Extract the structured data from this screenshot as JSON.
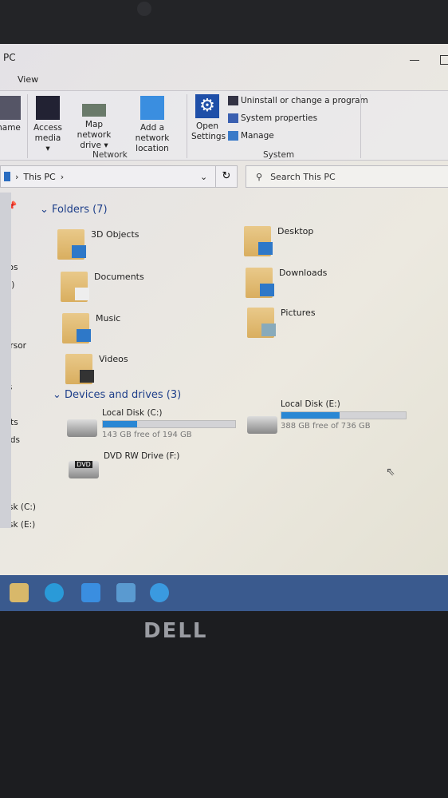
{
  "window": {
    "title": "PC",
    "tab": "View"
  },
  "ribbon": {
    "rename": "name",
    "access_media": "Access media ▾",
    "map_drive": "Map network drive ▾",
    "add_location": "Add a network location",
    "network_group": "Network",
    "open_settings": "Open Settings",
    "uninstall": "Uninstall or change a program",
    "system_properties": "System properties",
    "manage": "Manage",
    "system_group": "System"
  },
  "address": {
    "path": "This PC",
    "search_placeholder": "Search This PC"
  },
  "nav": [
    "otos",
    "(E:)",
    "Persor",
    "cts",
    "ents",
    "oads",
    "es",
    ":",
    "Disk (C:)",
    "Disk (E:)"
  ],
  "folders": {
    "header": "Folders (7)",
    "items": [
      "3D Objects",
      "Desktop",
      "Documents",
      "Downloads",
      "Music",
      "Pictures",
      "Videos"
    ]
  },
  "drives": {
    "header": "Devices and drives (3)",
    "items": [
      {
        "name": "Local Disk (C:)",
        "free": "143 GB free of 194 GB",
        "used_pct": 26
      },
      {
        "name": "Local Disk (E:)",
        "free": "388 GB free of 736 GB",
        "used_pct": 47
      },
      {
        "name": "DVD RW Drive (F:)",
        "label": "DVD"
      }
    ]
  },
  "brand": "DELL",
  "colors": {
    "accent": "#2a87d4",
    "taskbar": "#3a5a8e"
  }
}
